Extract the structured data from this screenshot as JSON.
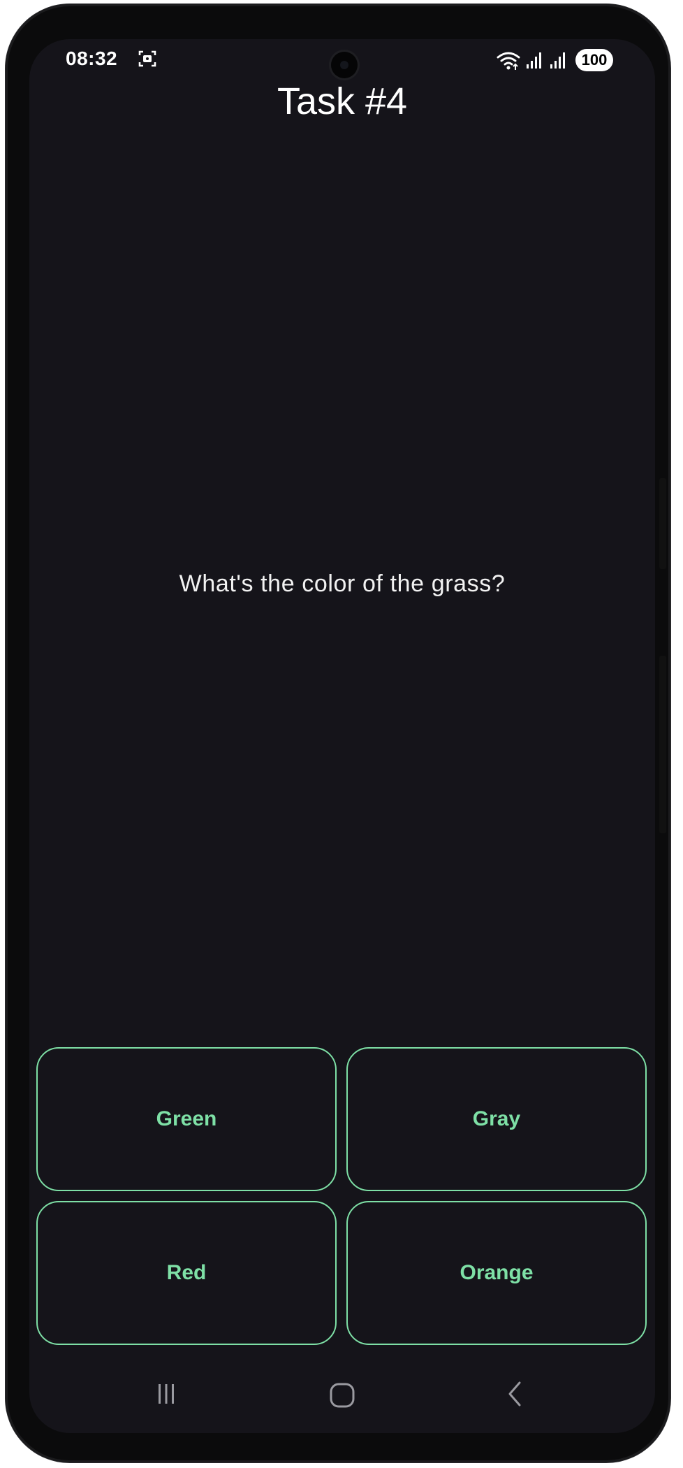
{
  "status_bar": {
    "time": "08:32",
    "battery": "100",
    "icons": [
      "screenshot-icon",
      "wifi-icon",
      "signal-icon",
      "signal-icon"
    ]
  },
  "page": {
    "title": "Task #4",
    "question": "What's the color of the grass?"
  },
  "answers": [
    {
      "label": "Green"
    },
    {
      "label": "Gray"
    },
    {
      "label": "Red"
    },
    {
      "label": "Orange"
    }
  ],
  "nav_bar": {
    "icons": [
      "recent-apps-icon",
      "home-icon",
      "back-icon"
    ]
  },
  "colors": {
    "background": "#15141a",
    "accent": "#7ee0a6",
    "text": "#ffffff"
  }
}
